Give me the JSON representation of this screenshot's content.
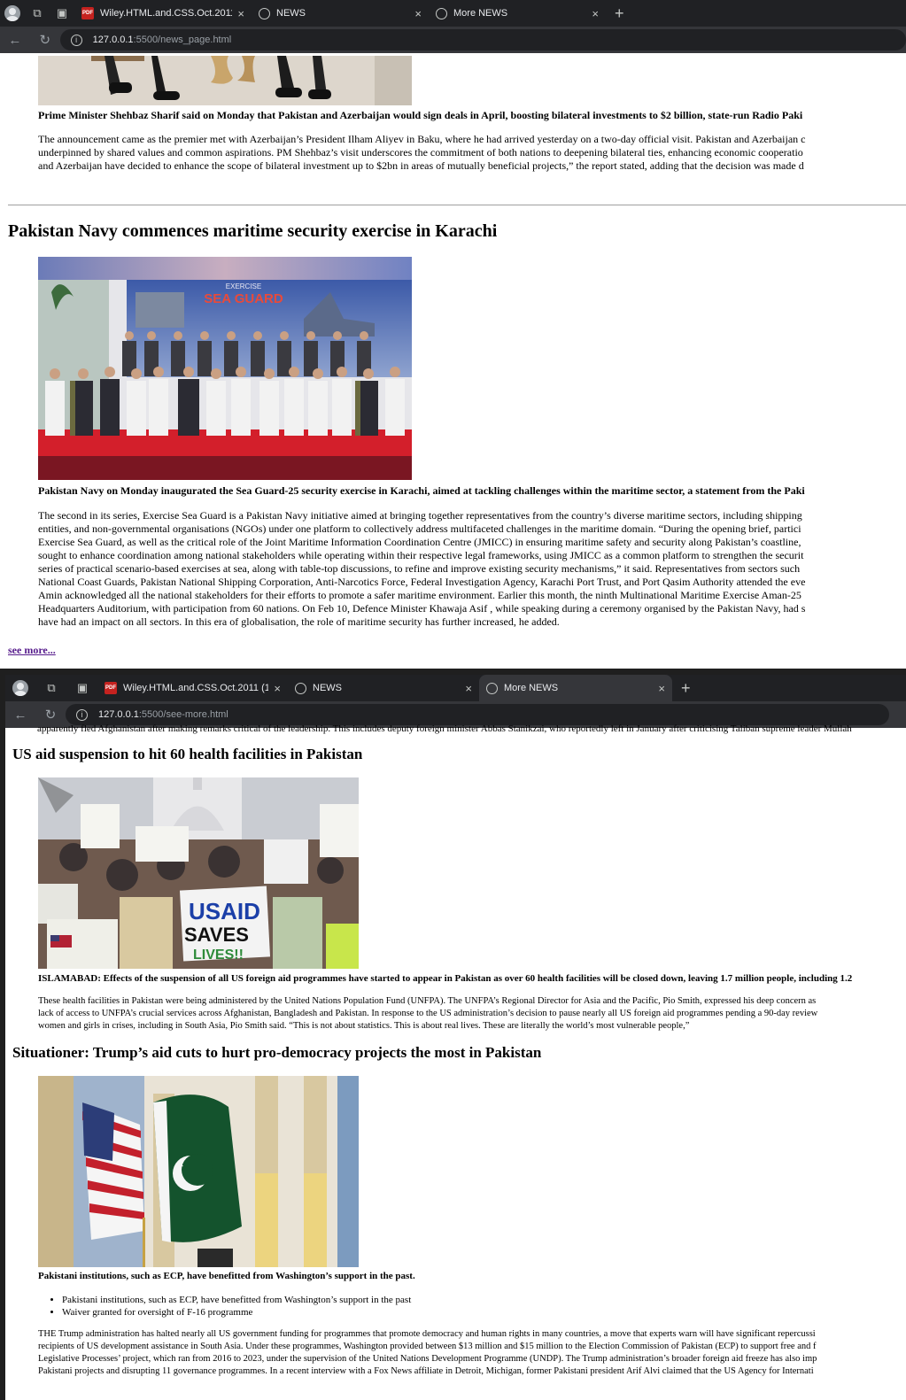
{
  "window1": {
    "tabs": [
      {
        "title": "Wiley.HTML.and.CSS.Oct.2011 (1)",
        "icon": "pdf-icon",
        "active": false
      },
      {
        "title": "NEWS",
        "icon": "globe-icon",
        "active": false
      },
      {
        "title": "More NEWS",
        "icon": "globe-icon",
        "active": false
      }
    ],
    "url_host": "127.0.0.1",
    "url_path": ":5500/news_page.html",
    "article1": {
      "lead": "Prime Minister Shehbaz Sharif said on Monday that Pakistan and Azerbaijan would sign deals in April, boosting bilateral investments to $2 billion, state-run Radio Paki",
      "body": [
        "The announcement came as the premier met with Azerbaijan’s President Ilham Aliyev in Baku, where he had arrived yesterday on a two-day official visit. Pakistan and Azerbaijan c",
        "underpinned by shared values and common aspirations. PM Shehbaz’s visit underscores the commitment of both nations to deepening bilateral ties, enhancing economic cooperatio",
        "and Azerbaijan have decided to enhance the scope of bilateral investment up to $2bn in areas of mutually beneficial projects,” the report stated, adding that the decision was made d"
      ]
    },
    "article2": {
      "headline": "Pakistan Navy commences maritime security exercise in Karachi",
      "banner_line1": "EXERCISE",
      "banner_line2": "SEA GUARD",
      "lead": "Pakistan Navy on Monday inaugurated the Sea Guard-25 security exercise in Karachi, aimed at tackling challenges within the maritime sector, a statement from the Paki",
      "body": [
        "The second in its series, Exercise Sea Guard is a Pakistan Navy initiative aimed at bringing together representatives from the country’s diverse maritime sectors, including shipping",
        "entities, and non-governmental organisations (NGOs) under one platform to collectively address multifaceted challenges in the maritime domain. “During the opening brief, partici",
        "Exercise Sea Guard, as well as the critical role of the Joint Maritime Information Coordination Centre (JMICC) in ensuring maritime safety and security along Pakistan’s coastline,",
        "sought to enhance coordination among national stakeholders while operating within their respective legal frameworks, using JMICC as a common platform to strengthen the securit",
        "series of practical scenario-based exercises at sea, along with table-top discussions, to refine and improve existing security mechanisms,” it said. Representatives from sectors such",
        "National Coast Guards, Pakistan National Shipping Corporation, Anti-Narcotics Force, Federal Investigation Agency, Karachi Port Trust, and Port Qasim Authority attended the eve",
        "Amin acknowledged all the national stakeholders for their efforts to promote a safer maritime environment. Earlier this month, the ninth Multinational Maritime Exercise Aman-25",
        "Headquarters Auditorium, with participation from 60 nations. On Feb 10, Defence Minister Khawaja Asif , while speaking during a ceremony organised by the Pakistan Navy, had s",
        "have had an impact on all sectors. In this era of globalisation, the role of maritime security has further increased, he added."
      ]
    },
    "see_more": "see more..."
  },
  "window2": {
    "tabs": [
      {
        "title": "Wiley.HTML.and.CSS.Oct.2011 (1)",
        "icon": "pdf-icon",
        "active": false
      },
      {
        "title": "NEWS",
        "icon": "globe-icon",
        "active": false
      },
      {
        "title": "More NEWS",
        "icon": "globe-icon",
        "active": true
      }
    ],
    "url_host": "127.0.0.1",
    "url_path": ":5500/see-more.html",
    "cutoff_line": "apparently fled Afghanistan after making remarks critical of the leadership. This includes deputy foreign minister Abbas Stanikzai, who reportedly left in January after criticising Taliban supreme leader Mullah",
    "article3": {
      "headline": "US aid suspension to hit 60 health facilities in Pakistan",
      "sign_text": "USAID SAVES LIVES!!",
      "lead": "ISLAMABAD: Effects of the suspension of all US foreign aid programmes have started to appear in Pakistan as over 60 health facilities will be closed down, leaving 1.7 million people, including 1.2",
      "body": [
        "These health facilities in Pakistan were being administered by the United Nations Population Fund (UNFPA). The UNFPA’s Regional Director for Asia and the Pacific, Pio Smith, expressed his deep concern as",
        "lack of access to UNFPA’s crucial services across Afghanistan, Bangladesh and Pakistan. In response to the US administration’s decision to pause nearly all US foreign aid programmes pending a 90-day review",
        "women and girls in crises, including in South Asia, Pio Smith said. “This is not about statistics. This is about real lives. These are literally the world’s most vulnerable people,”"
      ]
    },
    "article4": {
      "headline": "Situationer: Trump’s aid cuts to hurt pro-democracy projects the most in Pakistan",
      "lead": "Pakistani institutions, such as ECP, have benefitted from Washington’s support in the past.",
      "bullets": [
        "Pakistani institutions, such as ECP, have benefitted from Washington’s support in the past",
        "Waiver granted for oversight of F-16 programme"
      ],
      "body": [
        "THE Trump administration has halted nearly all US government funding for programmes that promote democracy and human rights in many countries, a move that experts warn will have significant repercussi",
        "recipients of US development assistance in South Asia. Under these programmes, Washington provided between $13 million and $15 million to the Election Commission of Pakistan (ECP) to support free and f",
        "Legislative Processes’ project, which ran from 2016 to 2023, under the supervision of the United Nations Development Programme (UNDP). The Trump administration’s broader foreign aid freeze has also imp",
        "Pakistani projects and disrupting 11 governance programmes. In a recent interview with a Fox News affiliate in Detroit, Michigan, former Pakistani president Arif Alvi claimed that the US Agency for Internati"
      ]
    }
  }
}
